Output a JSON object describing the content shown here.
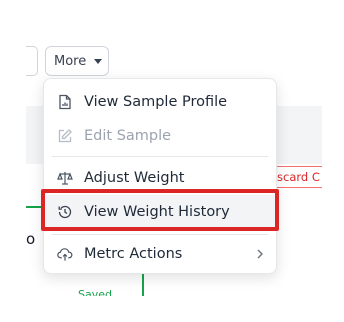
{
  "toolbar": {
    "more_label": "More"
  },
  "menu": {
    "items": [
      {
        "label": "View Sample Profile",
        "icon": "document-chart-icon",
        "disabled": false
      },
      {
        "label": "Edit Sample",
        "icon": "edit-icon",
        "disabled": true
      },
      {
        "label": "Adjust Weight",
        "icon": "scale-icon",
        "disabled": false
      },
      {
        "label": "View Weight History",
        "icon": "history-icon",
        "disabled": false,
        "highlighted": true
      },
      {
        "label": "Metrc Actions",
        "icon": "cloud-upload-icon",
        "disabled": false,
        "has_submenu": true
      }
    ]
  },
  "background": {
    "discard_chip": "scard C",
    "edge_letter": "o",
    "saved_text": "Saved"
  },
  "colors": {
    "highlight": "#dc2626",
    "discard": "#dc2626",
    "saved": "#16a34a"
  }
}
